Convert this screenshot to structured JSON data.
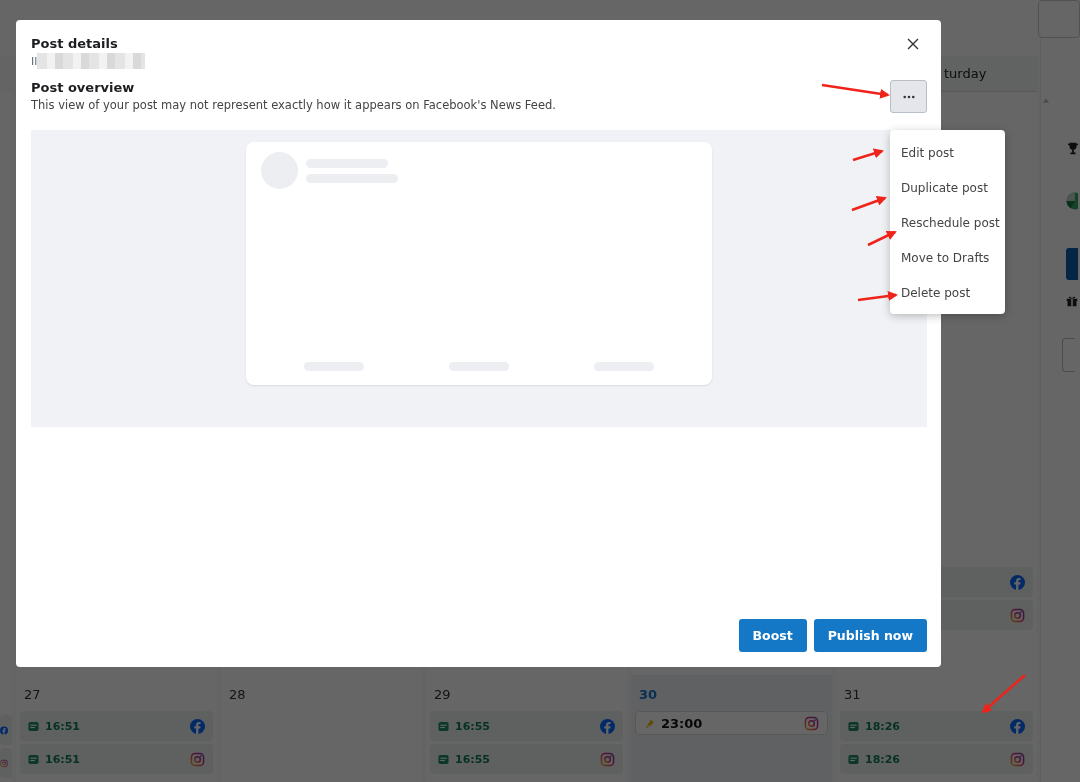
{
  "calendar": {
    "weekday_header": "turday",
    "week_one_events": [
      {
        "network": {
          "kind": "facebook"
        }
      },
      {
        "network": {
          "kind": "instagram"
        }
      }
    ],
    "edge_events": [
      {
        "network": {
          "kind": "facebook"
        }
      },
      {
        "network": {
          "kind": "instagram"
        }
      }
    ],
    "days": [
      {
        "number": "27",
        "today": false,
        "events": [
          {
            "kind": "post",
            "time": "16:51",
            "network": {
              "kind": "facebook"
            }
          },
          {
            "kind": "post",
            "time": "16:51",
            "network": {
              "kind": "instagram"
            }
          }
        ]
      },
      {
        "number": "28",
        "today": false
      },
      {
        "number": "29",
        "today": false,
        "events": [
          {
            "kind": "post",
            "time": "16:55",
            "network": {
              "kind": "facebook"
            }
          },
          {
            "kind": "post",
            "time": "16:55",
            "network": {
              "kind": "instagram"
            }
          }
        ]
      },
      {
        "number": "30",
        "today": true,
        "events": [
          {
            "kind": "pinned",
            "time": "23:00",
            "network": {
              "kind": "instagram"
            }
          }
        ]
      },
      {
        "number": "31",
        "today": false,
        "events": [
          {
            "kind": "post",
            "time": "18:26",
            "network": {
              "kind": "facebook"
            }
          },
          {
            "kind": "post",
            "time": "18:26",
            "network": {
              "kind": "instagram"
            }
          }
        ]
      }
    ]
  },
  "modal": {
    "title": "Post details",
    "subtitle": "Il",
    "section_title": "Post overview",
    "description": "This view of your post may not represent exactly how it appears on Facebook's News Feed.",
    "actions": [
      {
        "label": "Boost"
      },
      {
        "label": "Publish now"
      }
    ]
  },
  "menu": {
    "items": [
      {
        "label": "Edit post"
      },
      {
        "label": "Duplicate post"
      },
      {
        "label": "Reschedule post"
      },
      {
        "label": "Move to Drafts"
      },
      {
        "label": "Delete post"
      }
    ]
  }
}
